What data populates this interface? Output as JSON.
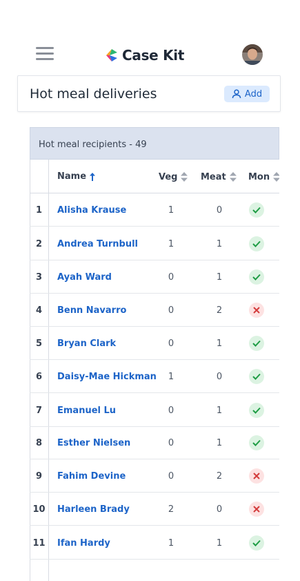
{
  "app": {
    "logo_text": "Case Kit"
  },
  "header": {
    "title": "Hot meal deliveries",
    "add_label": "Add"
  },
  "table": {
    "caption": "Hot meal recipients - 49",
    "columns": {
      "name": "Name",
      "veg": "Veg",
      "meat": "Meat",
      "mon": "Mon"
    },
    "sort": {
      "column": "Name",
      "direction": "ascending"
    },
    "rows": [
      {
        "num": "1",
        "name": "Alisha Krause",
        "veg": "1",
        "meat": "0",
        "mon": true
      },
      {
        "num": "2",
        "name": "Andrea Turnbull",
        "veg": "1",
        "meat": "1",
        "mon": true
      },
      {
        "num": "3",
        "name": "Ayah Ward",
        "veg": "0",
        "meat": "1",
        "mon": true
      },
      {
        "num": "4",
        "name": "Benn Navarro",
        "veg": "0",
        "meat": "2",
        "mon": false
      },
      {
        "num": "5",
        "name": "Bryan Clark",
        "veg": "0",
        "meat": "1",
        "mon": true
      },
      {
        "num": "6",
        "name": "Daisy-Mae Hickman",
        "veg": "1",
        "meat": "0",
        "mon": true
      },
      {
        "num": "7",
        "name": "Emanuel Lu",
        "veg": "0",
        "meat": "1",
        "mon": true
      },
      {
        "num": "8",
        "name": "Esther Nielsen",
        "veg": "0",
        "meat": "1",
        "mon": true
      },
      {
        "num": "9",
        "name": "Fahim Devine",
        "veg": "0",
        "meat": "2",
        "mon": false
      },
      {
        "num": "10",
        "name": "Harleen Brady",
        "veg": "2",
        "meat": "0",
        "mon": false
      },
      {
        "num": "11",
        "name": "Ifan Hardy",
        "veg": "1",
        "meat": "1",
        "mon": true
      }
    ]
  },
  "colors": {
    "accent": "#1d64c8",
    "check": "#1f9d45",
    "cross": "#d33b3b",
    "caption_bg": "#dbe2ef"
  },
  "icons": {
    "menu": "hamburger-menu-icon",
    "add": "user-add-icon",
    "sort_asc": "arrow-up-icon",
    "sort": "sort-icon",
    "yes": "check-icon",
    "no": "cross-icon"
  }
}
